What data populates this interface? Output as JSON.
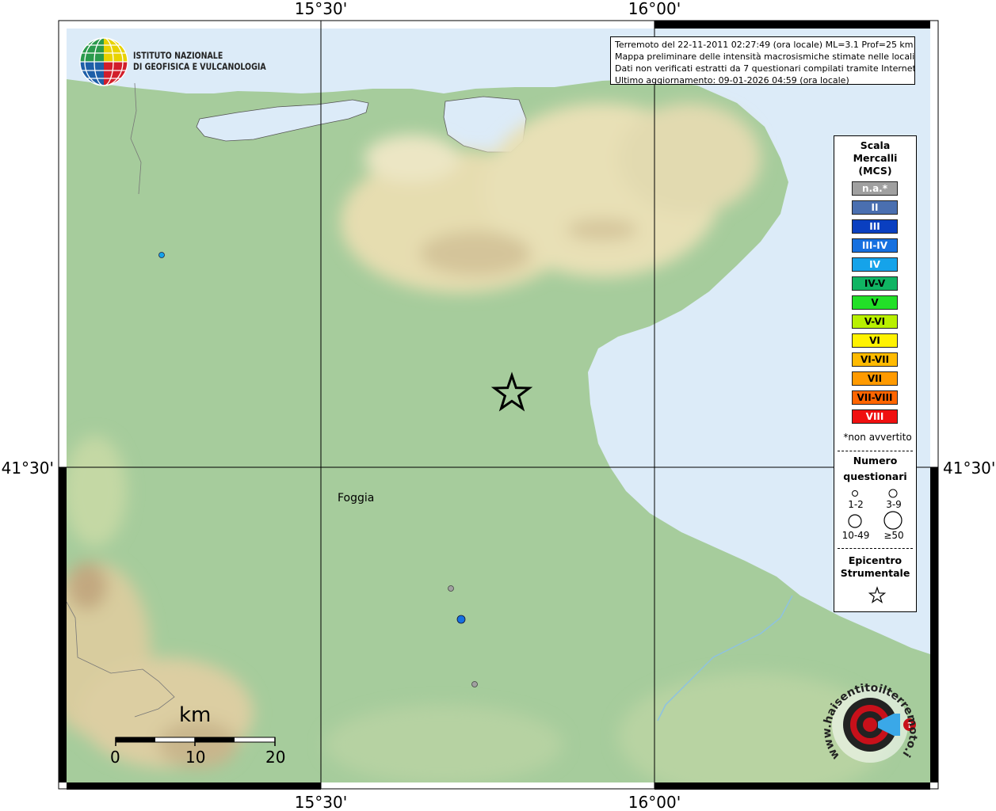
{
  "coords": {
    "lon_left": "15°30'",
    "lon_right": "16°00'",
    "lat": "41°30'"
  },
  "info": {
    "line1": "Terremoto del 22-11-2011 02:27:49 (ora locale) ML=3.1 Prof=25 km",
    "line2": "Mappa preliminare delle intensità macrosismiche stimate nelle località",
    "line3": "Dati non verificati estratti da 7 questionari compilati tramite Internet.",
    "line4": "Ultimo aggiornamento: 09-01-2026 04:59 (ora locale)"
  },
  "institute": {
    "line1": "ISTITUTO NAZIONALE",
    "line2": "DI GEOFISICA E VULCANOLOGIA"
  },
  "city": "Foggia",
  "legend": {
    "title1": "Scala",
    "title2": "Mercalli",
    "title3": "(MCS)",
    "classes": [
      {
        "label": "n.a.*",
        "color": "#a0a0a0",
        "text": "#ffffff"
      },
      {
        "label": "II",
        "color": "#4a6fb0",
        "text": "#ffffff"
      },
      {
        "label": "III",
        "color": "#0a3fc0",
        "text": "#ffffff"
      },
      {
        "label": "III-IV",
        "color": "#1670e0",
        "text": "#ffffff"
      },
      {
        "label": "IV",
        "color": "#15a3ea",
        "text": "#ffffff"
      },
      {
        "label": "IV-V",
        "color": "#10b463",
        "text": "#000000"
      },
      {
        "label": "V",
        "color": "#22e028",
        "text": "#000000"
      },
      {
        "label": "V-VI",
        "color": "#b8f000",
        "text": "#000000"
      },
      {
        "label": "VI",
        "color": "#fff200",
        "text": "#000000"
      },
      {
        "label": "VI-VII",
        "color": "#ffba00",
        "text": "#000000"
      },
      {
        "label": "VII",
        "color": "#ff9a00",
        "text": "#000000"
      },
      {
        "label": "VII-VIII",
        "color": "#ff6500",
        "text": "#000000"
      },
      {
        "label": "VIII",
        "color": "#f01010",
        "text": "#ffffff"
      }
    ],
    "note": "*non avvertito",
    "num_title1": "Numero",
    "num_title2": "questionari",
    "sizes": [
      "1-2",
      "3-9",
      "10-49",
      "≥50"
    ],
    "epi_title1": "Epicentro",
    "epi_title2": "Strumentale"
  },
  "scale": {
    "unit": "km",
    "ticks": [
      "0",
      "10",
      "20"
    ]
  },
  "observations": [
    {
      "intensity": "IV",
      "count_class": "1-2"
    },
    {
      "intensity": "n.a.*",
      "count_class": "1-2"
    },
    {
      "intensity": "III-IV",
      "count_class": "3-9"
    },
    {
      "intensity": "n.a.*",
      "count_class": "1-2"
    }
  ],
  "brand": "www.haisentitoilterremoto.it",
  "colors": {
    "sea": "#dcebf8",
    "lowland": "#a6cc9c",
    "hills": "#e4dcb0",
    "mountains": "#c8b48c"
  }
}
